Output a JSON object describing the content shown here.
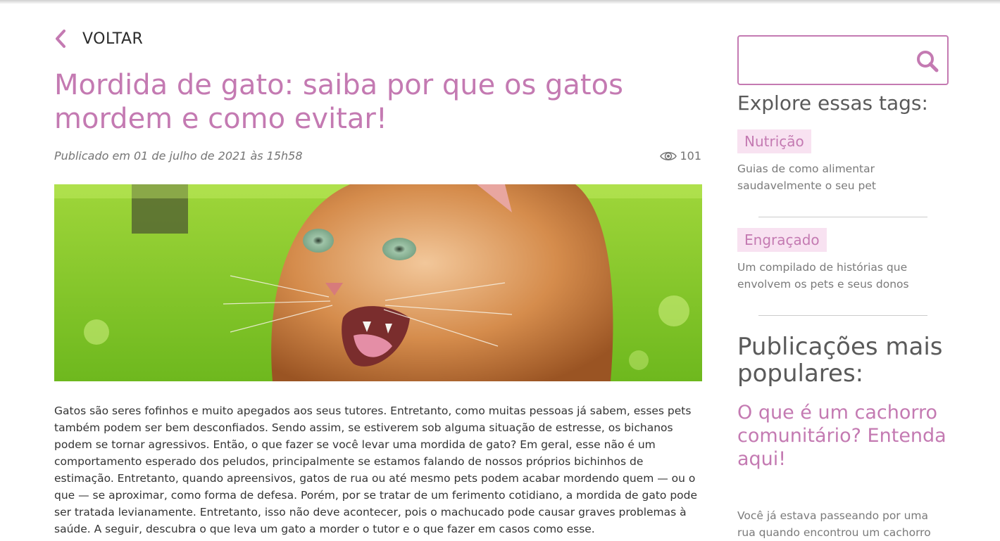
{
  "nav": {
    "back_label": "VOLTAR"
  },
  "article": {
    "title": "Mordida de gato: saiba por que os gatos mordem e como evitar!",
    "published": "Publicado em 01 de julho de 2021 às 15h58",
    "views": "101",
    "body": "Gatos são seres fofinhos e muito apegados aos seus tutores. Entretanto, como muitas pessoas já sabem, esses pets também podem ser bem desconfiados. Sendo assim, se estiverem sob alguma situação de estresse, os bichanos podem se tornar agressivos. Então, o que fazer se você levar uma mordida de gato? Em geral, esse não é um comportamento esperado dos peludos, principalmente se estamos falando de nossos próprios bichinhos de estimação. Entretanto, quando apreensivos, gatos de rua ou até mesmo pets podem acabar mordendo quem — ou o que — se aproximar, como forma de defesa. Porém, por se tratar de um ferimento cotidiano, a mordida de gato pode ser tratada levianamente. Entretanto, isso não deve acontecer, pois o machucado pode causar graves problemas à saúde. A seguir, descubra o que leva um gato a morder o tutor e o que fazer em casos como esse."
  },
  "search": {
    "placeholder": "",
    "value": ""
  },
  "sidebar": {
    "tags_heading": "Explore essas tags:",
    "tags": [
      {
        "label": "Nutrição",
        "description": "Guias de como alimentar saudavelmente o seu pet"
      },
      {
        "label": "Engraçado",
        "description": "Um compilado de histórias que envolvem os pets e seus donos"
      }
    ],
    "popular_heading": "Publicações mais populares:",
    "popular": [
      {
        "title": "O que é um cachorro comunitário? Entenda aqui!",
        "excerpt": "Você já estava passeando por uma rua quando encontrou um cachorro"
      }
    ]
  },
  "colors": {
    "accent": "#c47ab2",
    "tag_bg": "#f8e2f1",
    "text": "#333333",
    "muted": "#757575"
  },
  "icons": {
    "back": "chevron-left-icon",
    "views": "eye-icon",
    "search": "search-icon"
  }
}
